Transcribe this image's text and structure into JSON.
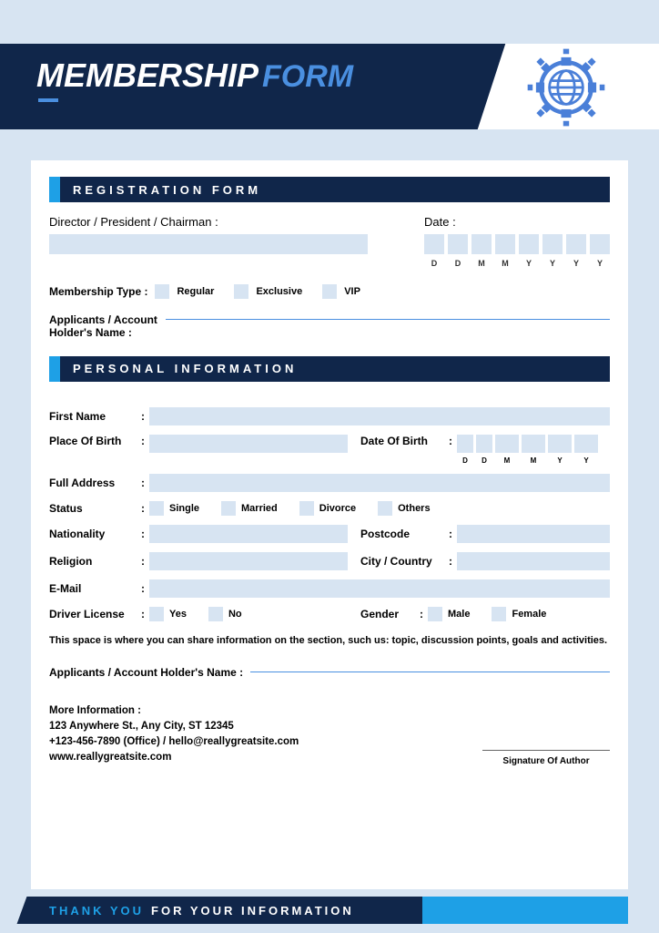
{
  "header": {
    "word1": "MEMBERSHIP",
    "word2": "FORM"
  },
  "sections": {
    "registration": "REGISTRATION FORM",
    "personal": "PERSONAL INFORMATION"
  },
  "labels": {
    "director": "Director / President / Chairman :",
    "date": "Date :",
    "membership_type": "Membership Type :",
    "applicant_name": "Applicants / Account Holder's Name :",
    "first_name": "First Name",
    "place_of_birth": "Place Of Birth",
    "date_of_birth": "Date Of Birth",
    "full_address": "Full Address",
    "status": "Status",
    "nationality": "Nationality",
    "postcode": "Postcode",
    "religion": "Religion",
    "city_country": "City / Country",
    "email": "E-Mail",
    "driver_license": "Driver License",
    "gender": "Gender",
    "applicant_name2": "Applicants / Account Holder's Name :",
    "more_info": "More Information :",
    "signature": "Signature Of Author"
  },
  "options": {
    "membership": [
      "Regular",
      "Exclusive",
      "VIP"
    ],
    "status": [
      "Single",
      "Married",
      "Divorce",
      "Others"
    ],
    "driver": [
      "Yes",
      "No"
    ],
    "gender": [
      "Male",
      "Female"
    ]
  },
  "date_letters": [
    "D",
    "D",
    "M",
    "M",
    "Y",
    "Y",
    "Y",
    "Y"
  ],
  "dob_letters": [
    "D",
    "D",
    "M",
    "M",
    "Y",
    "Y"
  ],
  "note": "This space is where you can share information on the section, such us: topic, discussion points, goals and activities.",
  "contact": {
    "address": "123 Anywhere St., Any City, ST 12345",
    "phone": "+123-456-7890 (Office) / hello@reallygreatsite.com",
    "web": "www.reallygreatsite.com"
  },
  "footer": {
    "part1": "THANK YOU",
    "part2": "FOR YOUR INFORMATION"
  }
}
